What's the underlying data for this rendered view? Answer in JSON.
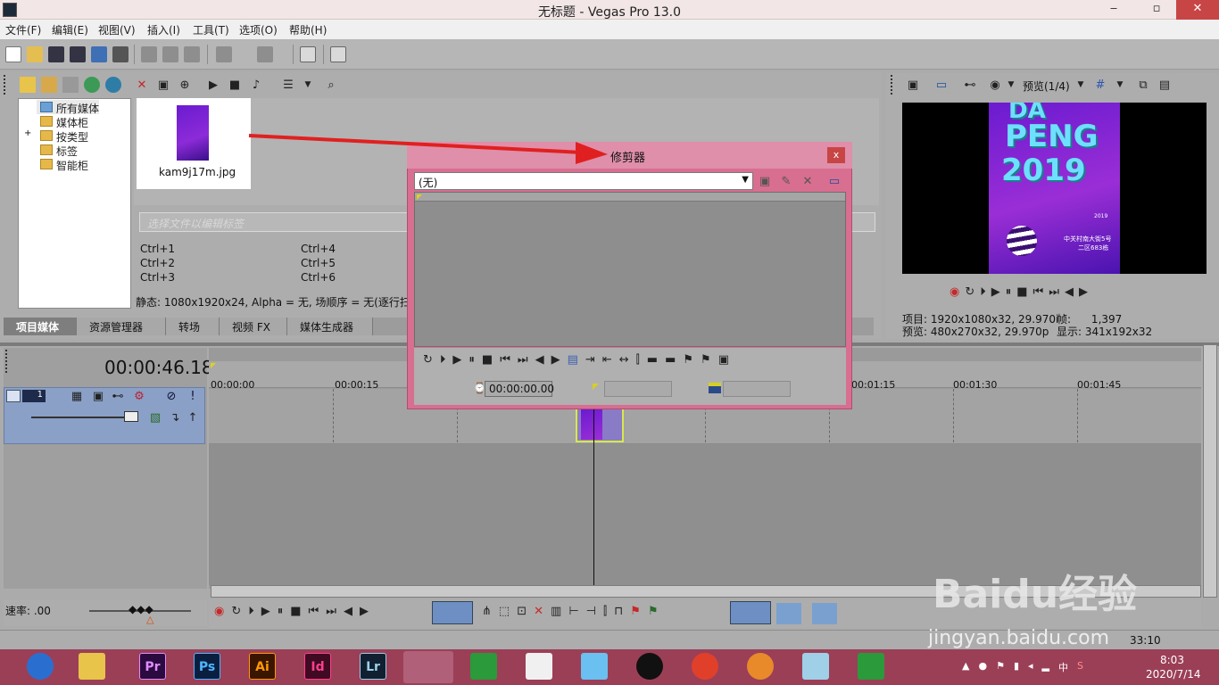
{
  "window": {
    "title": "无标题 - Vegas Pro 13.0",
    "min": "‒",
    "max": "▫",
    "close": "✕"
  },
  "menu": [
    "文件(F)",
    "编辑(E)",
    "视图(V)",
    "插入(I)",
    "工具(T)",
    "选项(O)",
    "帮助(H)"
  ],
  "media_tree": {
    "items": [
      "所有媒体",
      "媒体柜",
      "按类型",
      "标签",
      "智能柜"
    ],
    "expand": "+"
  },
  "media": {
    "file_name": "kam9j17m.jpg",
    "tag_placeholder": "选择文件以编辑标签",
    "shortcuts": [
      "Ctrl+1",
      "Ctrl+2",
      "Ctrl+3",
      "Ctrl+4",
      "Ctrl+5",
      "Ctrl+6"
    ],
    "status": "静态: 1080x1920x24, Alpha = 无, 场顺序 = 无(逐行扫描"
  },
  "tabs": [
    "项目媒体",
    "资源管理器",
    "转场",
    "视频 FX",
    "媒体生成器"
  ],
  "preview": {
    "mode_label": "预览(1/4)",
    "poster_text": [
      "DA",
      "PENG",
      "2019"
    ],
    "poster_small": [
      "2019",
      "中关村南大街5号",
      "二区683栋"
    ],
    "info_left": [
      "项目: 1920x1080x32, 29.970i",
      "预览: 480x270x32, 29.970p"
    ],
    "info_right": [
      "帧:      1,397",
      "显示: 341x192x32"
    ]
  },
  "timeline": {
    "timecode": "00:00:46.18",
    "track_number": "1",
    "ruler": [
      "00:00:00",
      "00:00:15",
      "00:01:15",
      "00:01:30",
      "00:01:45"
    ],
    "rate_label": "速率: .00"
  },
  "trimmer": {
    "title": "修剪器",
    "close": "x",
    "combo_value": "(无)",
    "timecode": "00:00:00.00"
  },
  "status": {
    "time_text": "33:10"
  },
  "tray": {
    "time": "8:03",
    "date": "2020/7/14",
    "ime": "中"
  },
  "taskbar_apps": [
    {
      "label": "Pr",
      "bg": "#2a0a3f",
      "fg": "#e08cff"
    },
    {
      "label": "Ps",
      "bg": "#0a1f3f",
      "fg": "#4fb6ff"
    },
    {
      "label": "Ai",
      "bg": "#3a1500",
      "fg": "#ff9a00"
    },
    {
      "label": "Id",
      "bg": "#3f0a22",
      "fg": "#ff3f8e"
    },
    {
      "label": "Lr",
      "bg": "#102030",
      "fg": "#9ccfe8"
    }
  ],
  "watermark": {
    "logo": "Baidu经验",
    "url": "jingyan.baidu.com"
  },
  "colors": {
    "taskbar": "#9b3f57",
    "trimmer": "#d86e90",
    "arrow": "#e02020"
  }
}
